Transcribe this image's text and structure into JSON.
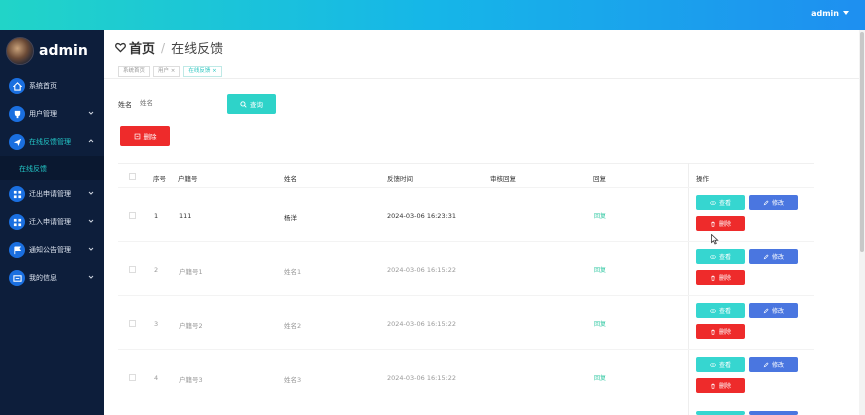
{
  "header": {
    "user": "admin"
  },
  "sidebar": {
    "brand": "admin",
    "items": [
      {
        "label": "系统首页",
        "icon": "home-icon"
      },
      {
        "label": "用户管理",
        "icon": "trophy-icon"
      },
      {
        "label": "在线反馈管理",
        "icon": "send-icon"
      },
      {
        "label": "迁出申请管理",
        "icon": "grid-icon"
      },
      {
        "label": "迁入申请管理",
        "icon": "grid-icon"
      },
      {
        "label": "通知公告管理",
        "icon": "flag-icon"
      },
      {
        "label": "我的信息",
        "icon": "card-icon"
      }
    ],
    "sub_item": "在线反馈"
  },
  "page": {
    "home": "首页",
    "current": "在线反馈",
    "tabs": [
      "系统首页",
      "用户 ×",
      "在线反馈 ×"
    ]
  },
  "search": {
    "label": "姓名",
    "placeholder": "姓名",
    "button": "查询"
  },
  "toolbar": {
    "delete": "删除"
  },
  "table": {
    "headers": [
      "序号",
      "户籍号",
      "姓名",
      "反馈时间",
      "审核回复",
      "回复",
      "操作"
    ],
    "rows": [
      {
        "index": "1",
        "huji": "111",
        "name": "杨洋",
        "time": "2024-03-06 16:23:31",
        "audit": "",
        "reply": "回复"
      },
      {
        "index": "2",
        "huji": "户籍号1",
        "name": "姓名1",
        "time": "2024-03-06 16:15:22",
        "audit": "",
        "reply": "回复"
      },
      {
        "index": "3",
        "huji": "户籍号2",
        "name": "姓名2",
        "time": "2024-03-06 16:15:22",
        "audit": "",
        "reply": "回复"
      },
      {
        "index": "4",
        "huji": "户籍号3",
        "name": "姓名3",
        "time": "2024-03-06 16:15:22",
        "audit": "",
        "reply": "回复"
      }
    ],
    "actions": {
      "view": "查看",
      "edit": "修改",
      "delete": "删除"
    }
  }
}
